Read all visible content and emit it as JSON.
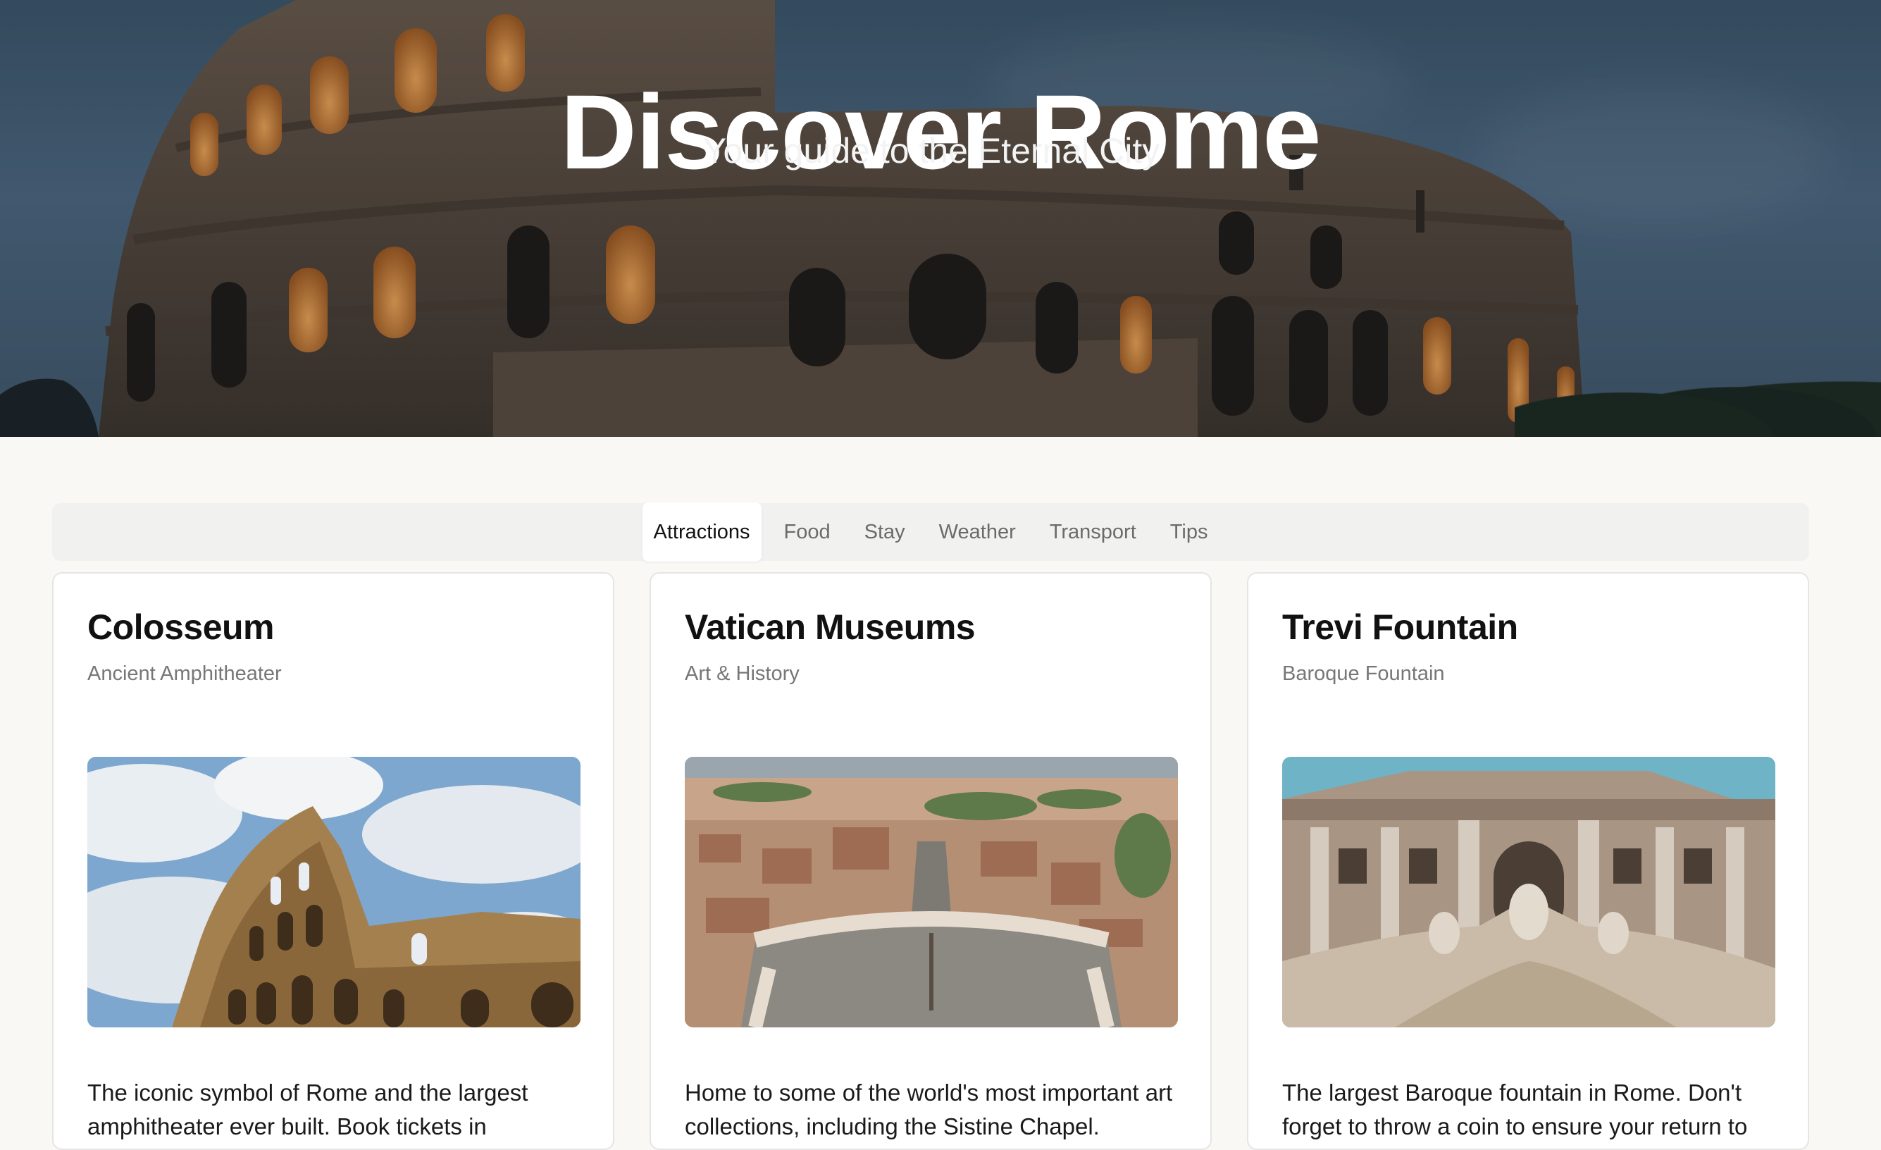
{
  "hero": {
    "title": "Discover Rome",
    "subtitle": "Your guide to the Eternal City",
    "image_icon": "colosseum-night-photo"
  },
  "tabs": [
    {
      "label": "Attractions",
      "active": true
    },
    {
      "label": "Food",
      "active": false
    },
    {
      "label": "Stay",
      "active": false
    },
    {
      "label": "Weather",
      "active": false
    },
    {
      "label": "Transport",
      "active": false
    },
    {
      "label": "Tips",
      "active": false
    }
  ],
  "cards": [
    {
      "title": "Colosseum",
      "subtitle": "Ancient Amphitheater",
      "image_icon": "colosseum-photo",
      "description": "The iconic symbol of Rome and the largest amphitheater ever built. Book tickets in"
    },
    {
      "title": "Vatican Museums",
      "subtitle": "Art & History",
      "image_icon": "st-peters-square-aerial-photo",
      "description": "Home to some of the world's most important art collections, including the Sistine Chapel."
    },
    {
      "title": "Trevi Fountain",
      "subtitle": "Baroque Fountain",
      "image_icon": "trevi-fountain-photo",
      "description": "The largest Baroque fountain in Rome. Don't forget to throw a coin to ensure your return to"
    }
  ],
  "colors": {
    "page_bg": "#f9f8f5",
    "accent_text": "#111111",
    "muted_text": "#6b6b6b"
  }
}
